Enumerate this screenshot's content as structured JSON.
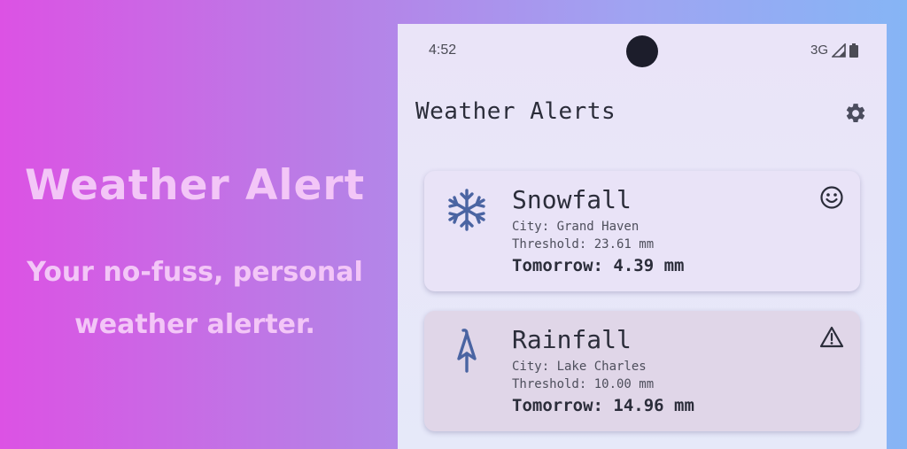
{
  "promo": {
    "title": "Weather Alert",
    "subtitle_line1": "Your no-fuss, personal",
    "subtitle_line2": "weather alerter."
  },
  "status_bar": {
    "time": "4:52",
    "network": "3G",
    "icons": [
      "signal-icon",
      "battery-icon"
    ]
  },
  "app_bar": {
    "title": "Weather Alerts",
    "settings_icon": "gear-icon"
  },
  "alerts": [
    {
      "type_icon": "snowflake-icon",
      "title": "Snowfall",
      "city": "City: Grand Haven",
      "threshold": "Threshold: 23.61 mm",
      "tomorrow": "Tomorrow: 4.39 mm",
      "status_icon": "smiley-icon"
    },
    {
      "type_icon": "umbrella-icon",
      "title": "Rainfall",
      "city": "City: Lake Charles",
      "threshold": "Threshold: 10.00 mm",
      "tomorrow": "Tomorrow: 14.96 mm",
      "status_icon": "warning-icon"
    }
  ],
  "colors": {
    "accent_icon": "#4a64a2",
    "card_normal": "#e9e3f7",
    "card_alert": "#e0d6e8",
    "promo_text": "#f3c6f7"
  }
}
